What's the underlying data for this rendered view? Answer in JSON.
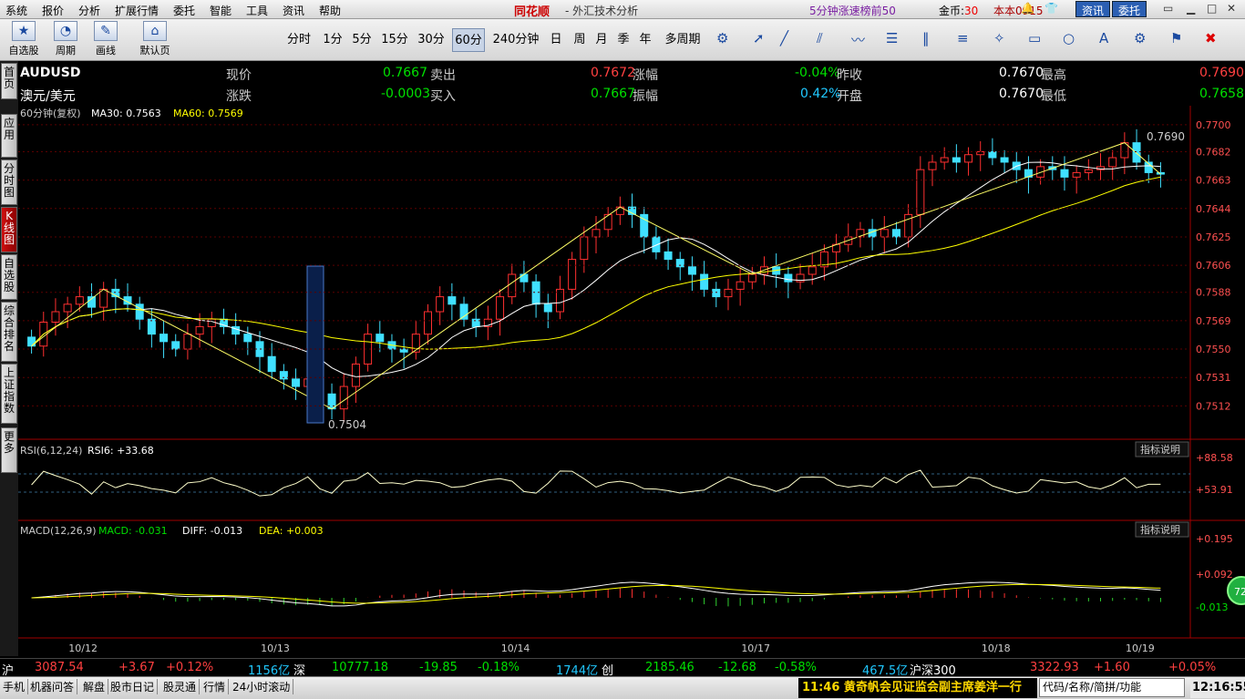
{
  "menu": {
    "items": [
      "系统",
      "报价",
      "分析",
      "扩展行情",
      "委托",
      "智能",
      "工具",
      "资讯",
      "帮助"
    ],
    "brand": "同花顺",
    "app_title": "- 外汇技术分析",
    "rank_link": "5分钟涨速榜前50",
    "gold_label": "金币:",
    "gold_value": "30",
    "version": "本本0915",
    "news_btn": "资讯",
    "trade_btn": "委托"
  },
  "toolbar": {
    "self_select": "自选股",
    "period": "周期",
    "draw": "画线",
    "home": "默认页",
    "periods": [
      "分时",
      "1分",
      "5分",
      "15分",
      "30分",
      "60分",
      "240分钟",
      "日",
      "周",
      "月",
      "季",
      "年",
      "多周期"
    ],
    "selected_period": "60分"
  },
  "sidebar": {
    "tabs": [
      "首页",
      "应用",
      "分时图",
      "K线图",
      "自选股",
      "综合排名",
      "上证指数",
      "更多"
    ]
  },
  "quote": {
    "symbol": "AUDUSD",
    "name": "澳元/美元",
    "now_label": "现价",
    "now_value": "0.7667",
    "sell_label": "卖出",
    "sell_value": "0.7672",
    "chg_pct_label": "涨幅",
    "chg_pct_value": "-0.04%",
    "prev_label": "昨收",
    "prev_value": "0.7670",
    "high_label": "最高",
    "high_value": "0.7690",
    "chg_label": "涨跌",
    "chg_value": "-0.0003",
    "buy_label": "买入",
    "buy_value": "0.7667",
    "amp_label": "振幅",
    "amp_value": "0.42%",
    "open_label": "开盘",
    "open_value": "0.7670",
    "low_label": "最低",
    "low_value": "0.7658"
  },
  "indicators": {
    "main_title": "60分钟(复权)",
    "ma30": "MA30: 0.7563",
    "ma60": "MA60: 0.7569",
    "rsi_title": "RSI(6,12,24)",
    "rsi6": "RSI6: +33.68",
    "macd_title": "MACD(12,26,9)",
    "macd_val": "MACD: -0.031",
    "diff_val": "DIFF: -0.013",
    "dea_val": "DEA: +0.003",
    "explain_btn": "指标说明",
    "high_mark": "0.7690",
    "low_mark": "0.7504"
  },
  "chart_data": {
    "type": "candlestick",
    "price_ticks": [
      "0.7700",
      "0.7682",
      "0.7663",
      "0.7644",
      "0.7625",
      "0.7606",
      "0.7588",
      "0.7569",
      "0.7550",
      "0.7531",
      "0.7512"
    ],
    "price_range": [
      0.7497,
      0.7703
    ],
    "rsi_ticks": [
      "+88.58",
      "+53.91"
    ],
    "macd_ticks": [
      "+0.195",
      "+0.092",
      "-0.013"
    ],
    "date_labels": [
      "10/12",
      "10/13",
      "10/14",
      "10/17",
      "10/18",
      "10/19"
    ],
    "candles_close": [
      0.7552,
      0.7568,
      0.7575,
      0.758,
      0.7585,
      0.7578,
      0.759,
      0.7585,
      0.758,
      0.757,
      0.756,
      0.7555,
      0.755,
      0.756,
      0.7565,
      0.757,
      0.7565,
      0.756,
      0.7555,
      0.7545,
      0.7535,
      0.753,
      0.7525,
      0.753,
      0.752,
      0.751,
      0.7525,
      0.754,
      0.756,
      0.7555,
      0.755,
      0.7548,
      0.756,
      0.7575,
      0.7585,
      0.758,
      0.757,
      0.7565,
      0.757,
      0.7585,
      0.76,
      0.7595,
      0.758,
      0.7575,
      0.759,
      0.761,
      0.7625,
      0.763,
      0.764,
      0.7645,
      0.764,
      0.7625,
      0.7615,
      0.761,
      0.7605,
      0.76,
      0.759,
      0.7585,
      0.759,
      0.7595,
      0.76,
      0.7605,
      0.76,
      0.7595,
      0.76,
      0.7605,
      0.7615,
      0.762,
      0.7625,
      0.763,
      0.7625,
      0.763,
      0.7625,
      0.764,
      0.767,
      0.7675,
      0.7678,
      0.7675,
      0.768,
      0.7682,
      0.7678,
      0.7675,
      0.767,
      0.7665,
      0.7672,
      0.767,
      0.7665,
      0.7668,
      0.767,
      0.7672,
      0.7678,
      0.7688,
      0.7675,
      0.7668,
      0.7667
    ],
    "ma60_axis_values": [
      0.7563,
      0.7569
    ],
    "rsi6_last": 33.68,
    "macd_last": -0.031,
    "diff_last": -0.013,
    "dea_last": 0.003
  },
  "status": {
    "sh_label": "沪",
    "sh_value": "3087.54",
    "sh_chg": "+3.67",
    "sh_pct": "+0.12%",
    "sh_amount": "1156亿",
    "sz_label": "深",
    "sz_value": "10777.18",
    "sz_chg": "-19.85",
    "sz_pct": "-0.18%",
    "sz_amount": "1744亿",
    "cy_label": "创",
    "cy_value": "2185.46",
    "cy_chg": "-12.68",
    "cy_pct": "-0.58%",
    "cy_amount": "467.5亿",
    "hs_label": "沪深300",
    "hs_value": "3322.93",
    "hs_chg": "+1.60",
    "hs_pct": "+0.05%"
  },
  "bottombar": {
    "tabs": [
      "手机",
      "机器问答",
      "解盘",
      "股市日记",
      "股灵通",
      "行情",
      "24小时滚动"
    ],
    "news": "11:46 黄奇帆会见证监会副主席姜洋一行",
    "search_placeholder": "代码/名称/简拼/功能",
    "clock": "12:16:55",
    "badge": "72"
  }
}
